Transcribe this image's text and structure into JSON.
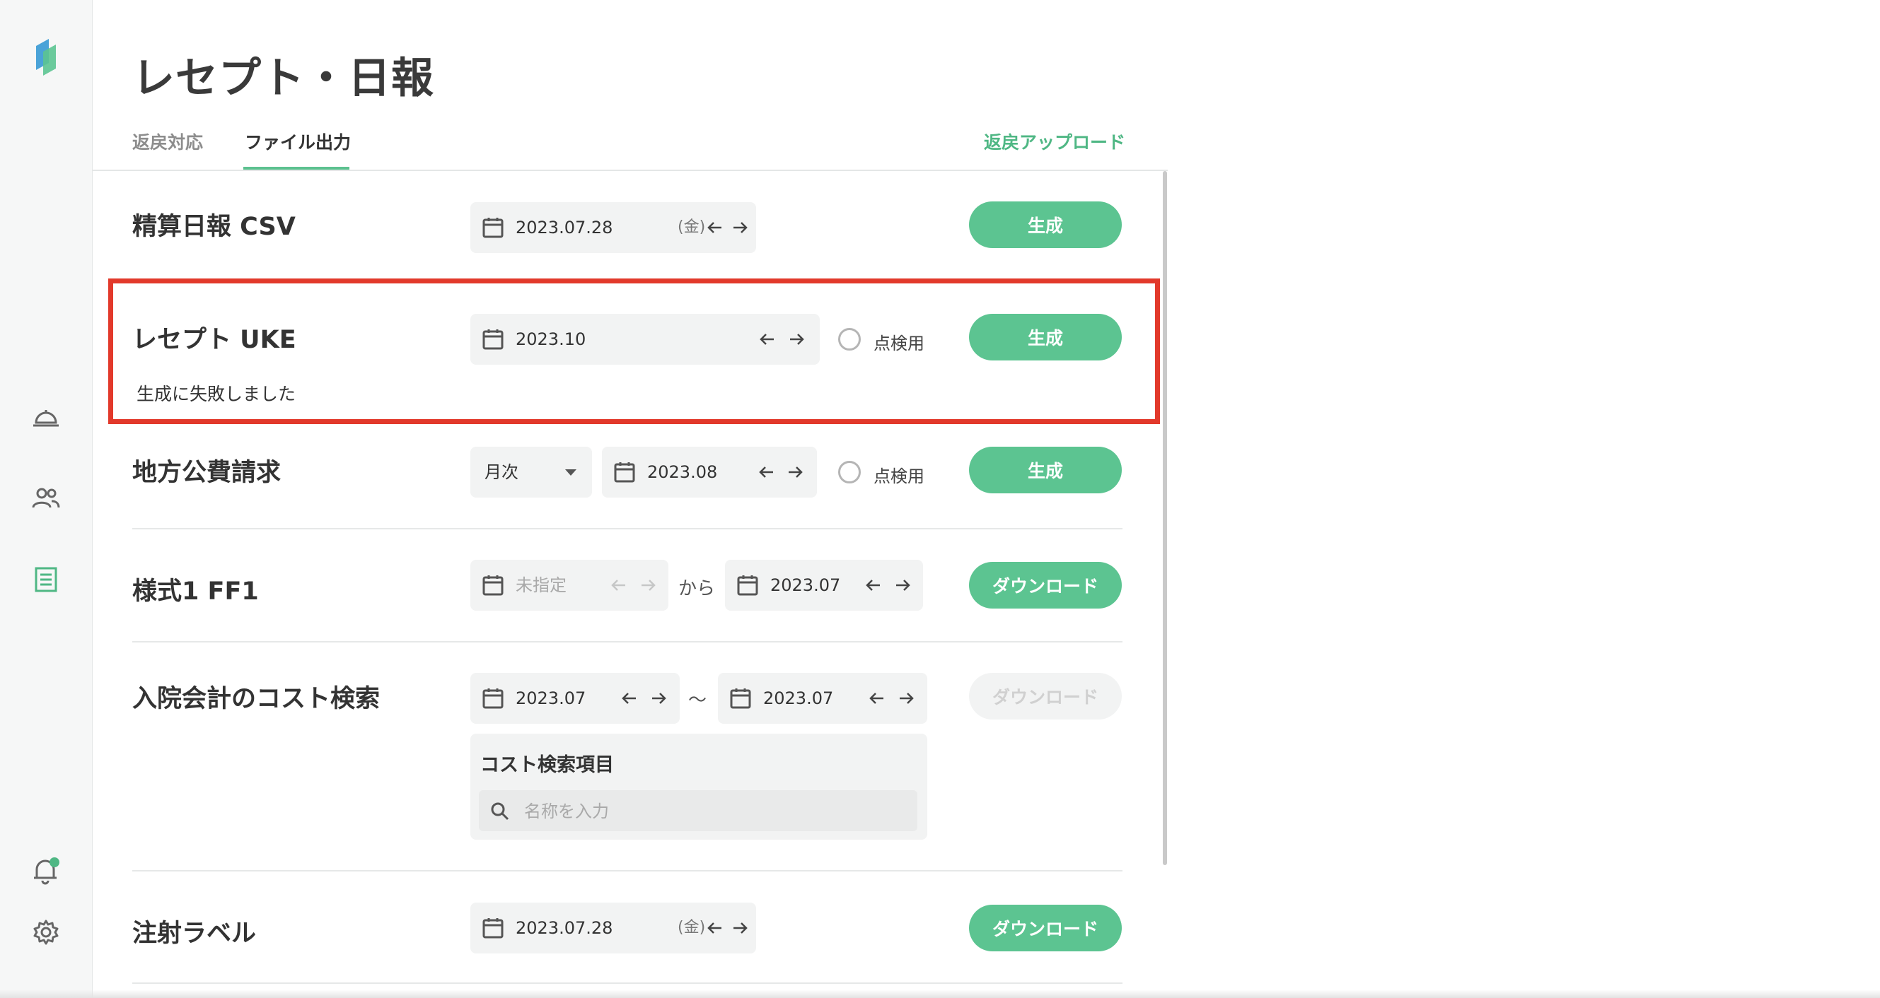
{
  "page": {
    "title": "レセプト・日報"
  },
  "tabs": [
    {
      "label": "返戻対応",
      "active": false
    },
    {
      "label": "ファイル出力",
      "active": true
    }
  ],
  "upload_link": "返戻アップロード",
  "sidebar": {
    "icons": [
      "app-logo-icon",
      "reception-bell-icon",
      "patients-icon",
      "documents-icon",
      "notifications-icon",
      "settings-icon"
    ],
    "accent": "#4fb784"
  },
  "rows": {
    "daily_csv": {
      "title": "精算日報 CSV",
      "date": "2023.07.28",
      "dow": "(金)",
      "button": "生成"
    },
    "receipt_uke": {
      "title": "レセプト UKE",
      "date": "2023.10",
      "check_label": "点検用",
      "button": "生成",
      "error": "生成に失敗しました"
    },
    "local_claims": {
      "title": "地方公費請求",
      "period": "月次",
      "date": "2023.08",
      "check_label": "点検用",
      "button": "生成"
    },
    "form_ff1": {
      "title": "様式1 FF1",
      "from_date": "未指定",
      "from_word": "から",
      "to_date": "2023.07",
      "button": "ダウンロード"
    },
    "cost_search": {
      "title": "入院会計のコスト検索",
      "from_date": "2023.07",
      "tilde": "〜",
      "to_date": "2023.07",
      "button": "ダウンロード",
      "panel_title": "コスト検索項目",
      "search_placeholder": "名称を入力"
    },
    "injection_label": {
      "title": "注射ラベル",
      "date": "2023.07.28",
      "dow": "(金)",
      "button": "ダウンロード"
    }
  },
  "colors": {
    "primary": "#5cc491",
    "highlight": "#e2392b"
  }
}
